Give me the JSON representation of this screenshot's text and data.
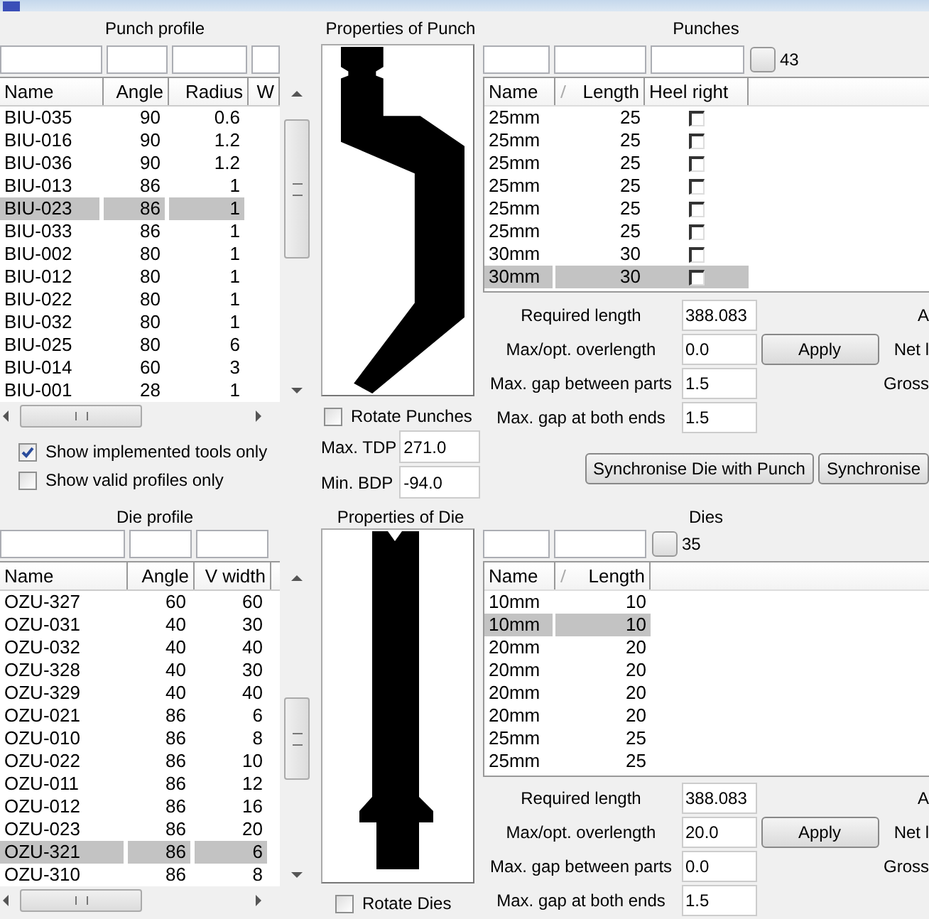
{
  "punch_profile": {
    "title": "Punch profile",
    "columns": [
      "Name",
      "Angle",
      "Radius",
      "W"
    ],
    "rows": [
      {
        "cells": [
          "BIU-035",
          "90",
          "0.6"
        ],
        "selected": false
      },
      {
        "cells": [
          "BIU-016",
          "90",
          "1.2"
        ],
        "selected": false
      },
      {
        "cells": [
          "BIU-036",
          "90",
          "1.2"
        ],
        "selected": false
      },
      {
        "cells": [
          "BIU-013",
          "86",
          "1"
        ],
        "selected": false
      },
      {
        "cells": [
          "BIU-023",
          "86",
          "1"
        ],
        "selected": true
      },
      {
        "cells": [
          "BIU-033",
          "86",
          "1"
        ],
        "selected": false
      },
      {
        "cells": [
          "BIU-002",
          "80",
          "1"
        ],
        "selected": false
      },
      {
        "cells": [
          "BIU-012",
          "80",
          "1"
        ],
        "selected": false
      },
      {
        "cells": [
          "BIU-022",
          "80",
          "1"
        ],
        "selected": false
      },
      {
        "cells": [
          "BIU-032",
          "80",
          "1"
        ],
        "selected": false
      },
      {
        "cells": [
          "BIU-025",
          "80",
          "6"
        ],
        "selected": false
      },
      {
        "cells": [
          "BIU-014",
          "60",
          "3"
        ],
        "selected": false
      },
      {
        "cells": [
          "BIU-001",
          "28",
          "1"
        ],
        "selected": false
      }
    ],
    "options": [
      {
        "label": "Show implemented tools only",
        "checked": true
      },
      {
        "label": "Show valid profiles only",
        "checked": false
      }
    ]
  },
  "punch_properties": {
    "title": "Properties of Punch",
    "rotate": {
      "label": "Rotate Punches",
      "checked": false
    },
    "fields": [
      {
        "label": "Max. TDP",
        "value": "271.0"
      },
      {
        "label": "Min. BDP",
        "value": "-94.0"
      }
    ]
  },
  "punches": {
    "title": "Punches",
    "count": "43",
    "columns": [
      {
        "label": "Name",
        "sorted": false
      },
      {
        "label": "Length",
        "sorted": true
      },
      {
        "label": "Heel right",
        "sorted": false
      }
    ],
    "rows": [
      {
        "cells": [
          "25mm",
          "25"
        ],
        "heel_right": false,
        "selected": false
      },
      {
        "cells": [
          "25mm",
          "25"
        ],
        "heel_right": false,
        "selected": false
      },
      {
        "cells": [
          "25mm",
          "25"
        ],
        "heel_right": false,
        "selected": false
      },
      {
        "cells": [
          "25mm",
          "25"
        ],
        "heel_right": false,
        "selected": false
      },
      {
        "cells": [
          "25mm",
          "25"
        ],
        "heel_right": false,
        "selected": false
      },
      {
        "cells": [
          "25mm",
          "25"
        ],
        "heel_right": false,
        "selected": false
      },
      {
        "cells": [
          "30mm",
          "30"
        ],
        "heel_right": false,
        "selected": false
      },
      {
        "cells": [
          "30mm",
          "30"
        ],
        "heel_right": false,
        "selected": true
      }
    ],
    "settings": [
      {
        "label": "Required length",
        "value": "388.083",
        "side_label": "A"
      },
      {
        "label": "Max/opt. overlength",
        "value": "0.0",
        "button": "Apply",
        "side_label": "Net l"
      },
      {
        "label": "Max. gap between parts",
        "value": "1.5",
        "side_label": "Gross"
      },
      {
        "label": "Max. gap at both ends",
        "value": "1.5"
      }
    ],
    "sync_buttons": [
      "Synchronise Die with Punch",
      "Synchronise"
    ]
  },
  "die_profile": {
    "title": "Die profile",
    "columns": [
      "Name",
      "Angle",
      "V width"
    ],
    "rows": [
      {
        "cells": [
          "OZU-327",
          "60",
          "60"
        ],
        "selected": false
      },
      {
        "cells": [
          "OZU-031",
          "40",
          "30"
        ],
        "selected": false
      },
      {
        "cells": [
          "OZU-032",
          "40",
          "40"
        ],
        "selected": false
      },
      {
        "cells": [
          "OZU-328",
          "40",
          "30"
        ],
        "selected": false
      },
      {
        "cells": [
          "OZU-329",
          "40",
          "40"
        ],
        "selected": false
      },
      {
        "cells": [
          "OZU-021",
          "86",
          "6"
        ],
        "selected": false
      },
      {
        "cells": [
          "OZU-010",
          "86",
          "8"
        ],
        "selected": false
      },
      {
        "cells": [
          "OZU-022",
          "86",
          "10"
        ],
        "selected": false
      },
      {
        "cells": [
          "OZU-011",
          "86",
          "12"
        ],
        "selected": false
      },
      {
        "cells": [
          "OZU-012",
          "86",
          "16"
        ],
        "selected": false
      },
      {
        "cells": [
          "OZU-023",
          "86",
          "20"
        ],
        "selected": false
      },
      {
        "cells": [
          "OZU-321",
          "86",
          "6"
        ],
        "selected": true
      },
      {
        "cells": [
          "OZU-310",
          "86",
          "8"
        ],
        "selected": false
      }
    ]
  },
  "die_properties": {
    "title": "Properties of Die",
    "rotate": {
      "label": "Rotate Dies",
      "checked": false
    }
  },
  "dies": {
    "title": "Dies",
    "count": "35",
    "columns": [
      {
        "label": "Name",
        "sorted": false
      },
      {
        "label": "Length",
        "sorted": true
      }
    ],
    "rows": [
      {
        "cells": [
          "10mm",
          "10"
        ],
        "selected": false
      },
      {
        "cells": [
          "10mm",
          "10"
        ],
        "selected": true
      },
      {
        "cells": [
          "20mm",
          "20"
        ],
        "selected": false
      },
      {
        "cells": [
          "20mm",
          "20"
        ],
        "selected": false
      },
      {
        "cells": [
          "20mm",
          "20"
        ],
        "selected": false
      },
      {
        "cells": [
          "20mm",
          "20"
        ],
        "selected": false
      },
      {
        "cells": [
          "25mm",
          "25"
        ],
        "selected": false
      },
      {
        "cells": [
          "25mm",
          "25"
        ],
        "selected": false
      }
    ],
    "settings": [
      {
        "label": "Required length",
        "value": "388.083",
        "side_label": "A"
      },
      {
        "label": "Max/opt. overlength",
        "value": "20.0",
        "button": "Apply",
        "side_label": "Net l"
      },
      {
        "label": "Max. gap between parts",
        "value": "0.0",
        "side_label": "Gross"
      },
      {
        "label": "Max. gap at both ends",
        "value": "1.5"
      }
    ]
  }
}
